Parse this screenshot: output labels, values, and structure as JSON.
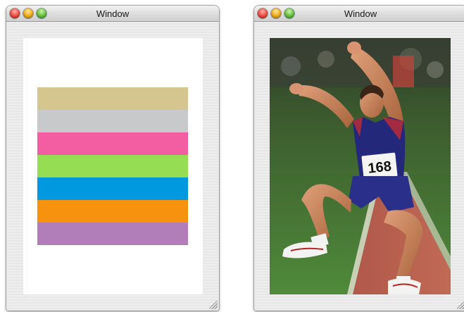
{
  "windows": [
    {
      "title": "Window",
      "stripe_colors": [
        "#d5c58f",
        "#c8c9cb",
        "#f35ea3",
        "#95dd53",
        "#0098df",
        "#f7920f",
        "#b27eba"
      ]
    },
    {
      "title": "Window",
      "photo": {
        "icon": "long-jumper-photo",
        "bib_number": "168"
      }
    }
  ]
}
